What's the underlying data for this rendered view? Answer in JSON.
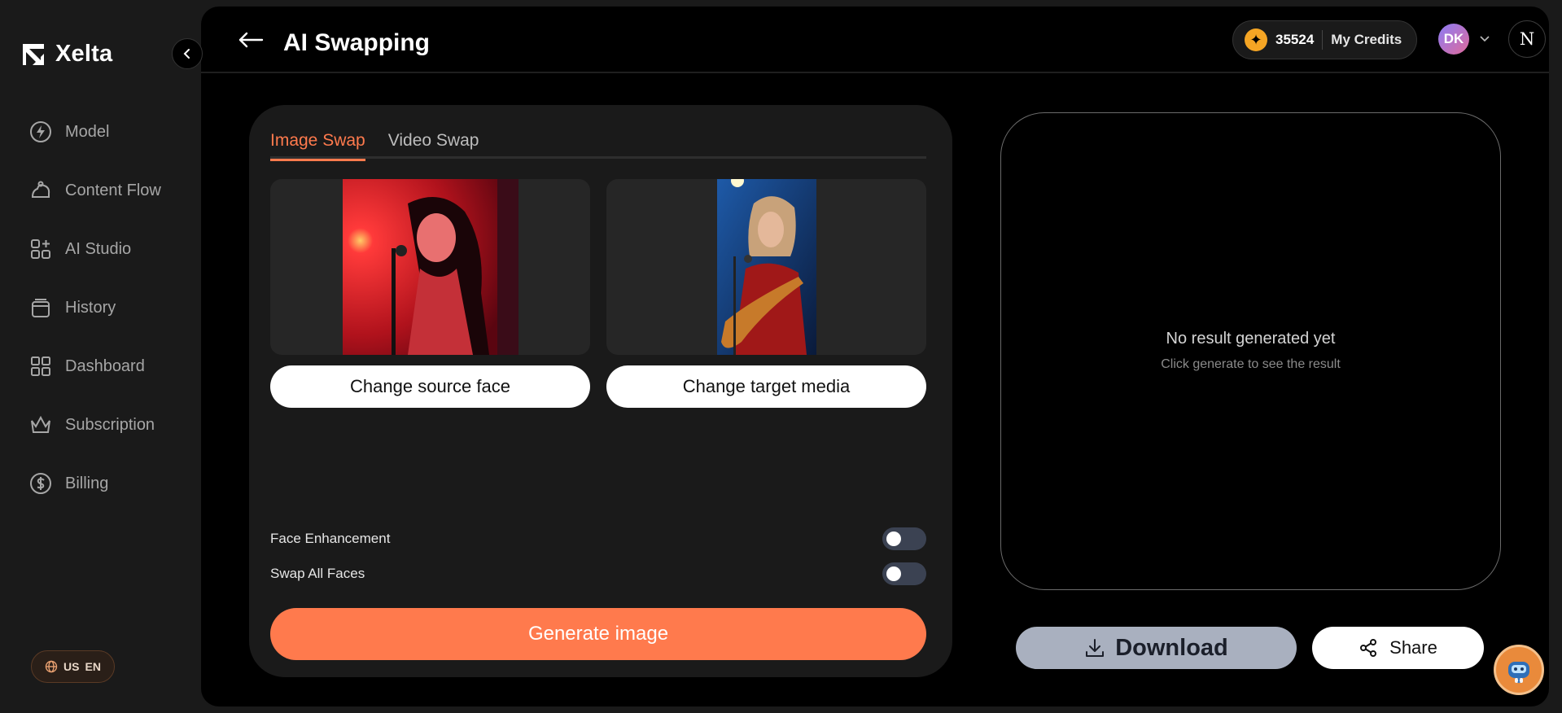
{
  "app": {
    "name": "Xelta"
  },
  "sidebar": {
    "items": [
      {
        "label": "Model",
        "icon": "bolt-circle-icon"
      },
      {
        "label": "Content Flow",
        "icon": "content-flow-icon"
      },
      {
        "label": "AI Studio",
        "icon": "grid-plus-icon"
      },
      {
        "label": "History",
        "icon": "history-box-icon"
      },
      {
        "label": "Dashboard",
        "icon": "dashboard-grid-icon"
      },
      {
        "label": "Subscription",
        "icon": "crown-icon"
      },
      {
        "label": "Billing",
        "icon": "dollar-circle-icon"
      }
    ],
    "language": {
      "region": "US",
      "lang": "EN"
    }
  },
  "header": {
    "title": "AI Swapping",
    "credits": {
      "amount": "35524",
      "label": "My Credits"
    },
    "avatar_initials": "DK",
    "badge": "N"
  },
  "panel": {
    "tabs": [
      {
        "label": "Image Swap",
        "active": true
      },
      {
        "label": "Video Swap",
        "active": false
      }
    ],
    "source_button": "Change source face",
    "target_button": "Change target media",
    "toggles": [
      {
        "label": "Face Enhancement",
        "on": false
      },
      {
        "label": "Swap All Faces",
        "on": false
      }
    ],
    "generate_label": "Generate image"
  },
  "result": {
    "title": "No result generated yet",
    "subtitle": "Click generate to see the result"
  },
  "actions": {
    "download_label": "Download",
    "share_label": "Share"
  },
  "colors": {
    "accent": "#ff7a4d",
    "coin": "#f5a524",
    "panel": "#1a1a1a"
  }
}
